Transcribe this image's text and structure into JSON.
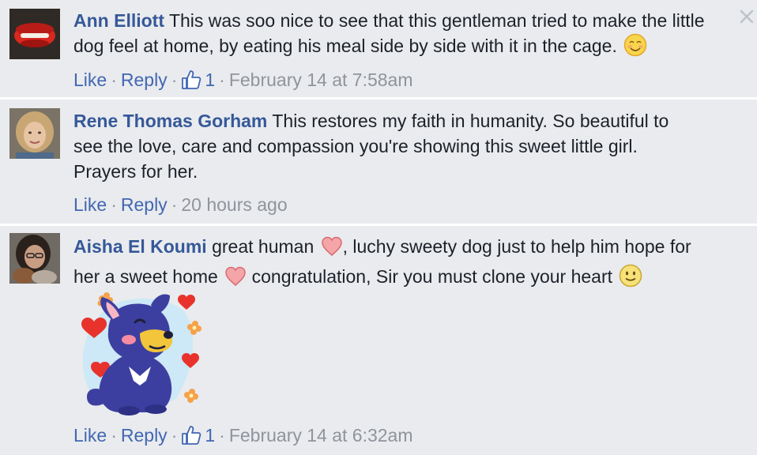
{
  "comments": [
    {
      "author": "Ann Elliott",
      "text": "This was soo nice to see that this gentleman tried to make the little dog feel at home, by eating his meal side by side with it in the cage.",
      "emoji": "smiling-face-icon",
      "actions": {
        "like": "Like",
        "reply": "Reply",
        "likes_count": "1",
        "timestamp": "February 14 at 7:58am"
      }
    },
    {
      "author": "Rene Thomas Gorham",
      "text_lines": [
        "This restores my faith in humanity. So beautiful to",
        "see the love, care and compassion you're showing this sweet little girl.",
        "Prayers for her."
      ],
      "actions": {
        "like": "Like",
        "reply": "Reply",
        "timestamp": "20 hours ago"
      }
    },
    {
      "author": "Aisha El Koumi",
      "text_part1": "great human",
      "text_part2": ", luchy sweety dog just to help him hope for",
      "text_part3": "her a sweet home",
      "text_part4": "congratulation, Sir you must clone your heart",
      "sticker": "puppy-hearts-sticker",
      "actions": {
        "like": "Like",
        "reply": "Reply",
        "likes_count": "1",
        "timestamp": "February 14 at 6:32am"
      }
    }
  ],
  "separator": "·",
  "colors": {
    "background": "#e9ebee",
    "author": "#365899",
    "link": "#4267b2",
    "meta": "#90949c",
    "text": "#1d2129"
  }
}
